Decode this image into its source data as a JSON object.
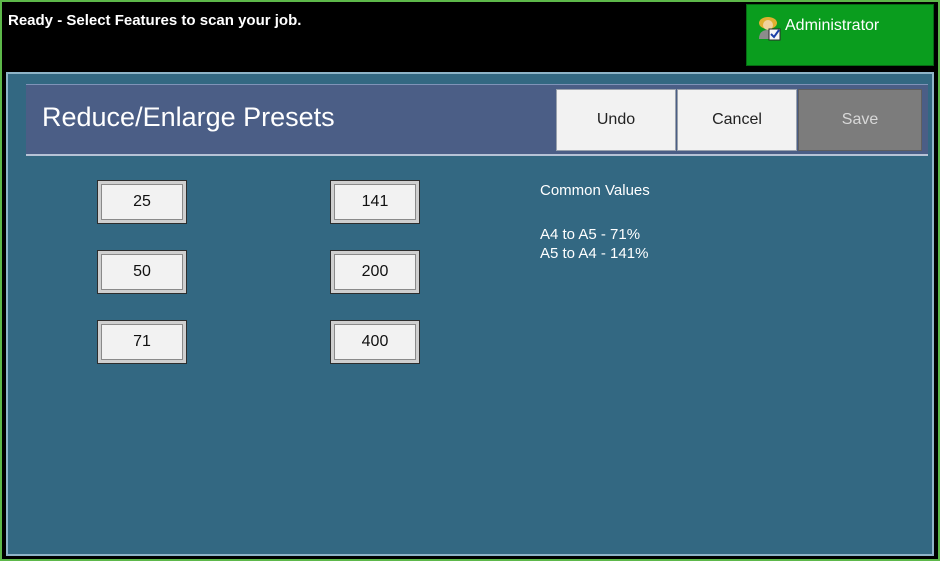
{
  "status": {
    "message": "Ready - Select Features to scan your job.",
    "admin_label": "Administrator",
    "admin_icon": "administrator-icon"
  },
  "header": {
    "title": "Reduce/Enlarge Presets",
    "undo": "Undo",
    "cancel": "Cancel",
    "save": "Save"
  },
  "presets": {
    "col1": [
      "25",
      "50",
      "71"
    ],
    "col2": [
      "141",
      "200",
      "400"
    ]
  },
  "info": {
    "heading": "Common Values",
    "lines": [
      "A4 to A5 - 71%",
      "A5 to A4 - 141%"
    ]
  },
  "colors": {
    "status_bar": "#000000",
    "admin_button": "#0a9d1e",
    "panel_bg": "#336882",
    "header_bg": "#4b5e86",
    "frame_border": "#5db84a"
  }
}
